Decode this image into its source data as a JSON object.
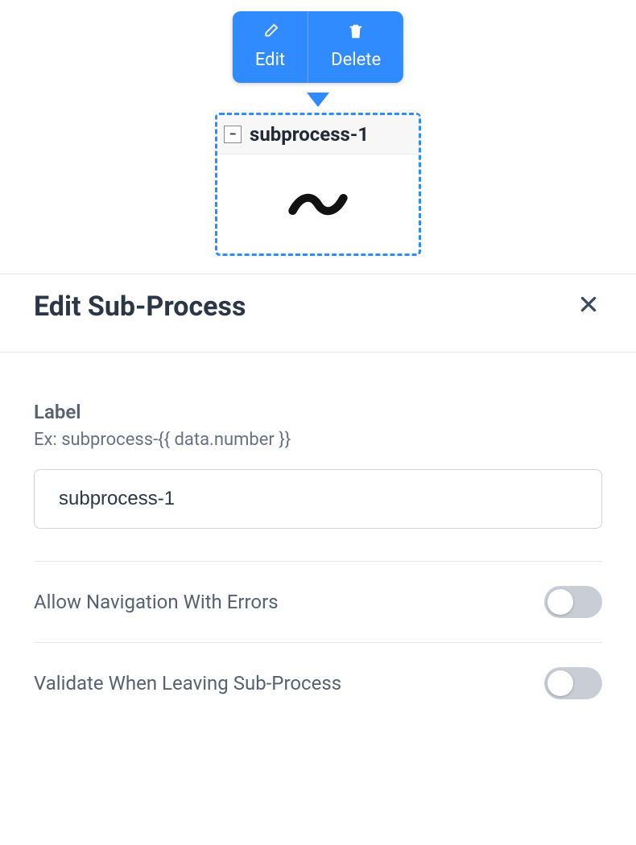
{
  "tooltip": {
    "edit_label": "Edit",
    "delete_label": "Delete"
  },
  "node": {
    "title": "subprocess-1",
    "collapse_symbol": "−",
    "body_glyph": "〰"
  },
  "panel": {
    "title": "Edit Sub-Process"
  },
  "form": {
    "label_heading": "Label",
    "label_hint": "Ex: subprocess-{{ data.number }}",
    "label_value": "subprocess-1",
    "allow_nav_label": "Allow Navigation With Errors",
    "allow_nav_value": false,
    "validate_label": "Validate When Leaving Sub-Process",
    "validate_value": false
  }
}
